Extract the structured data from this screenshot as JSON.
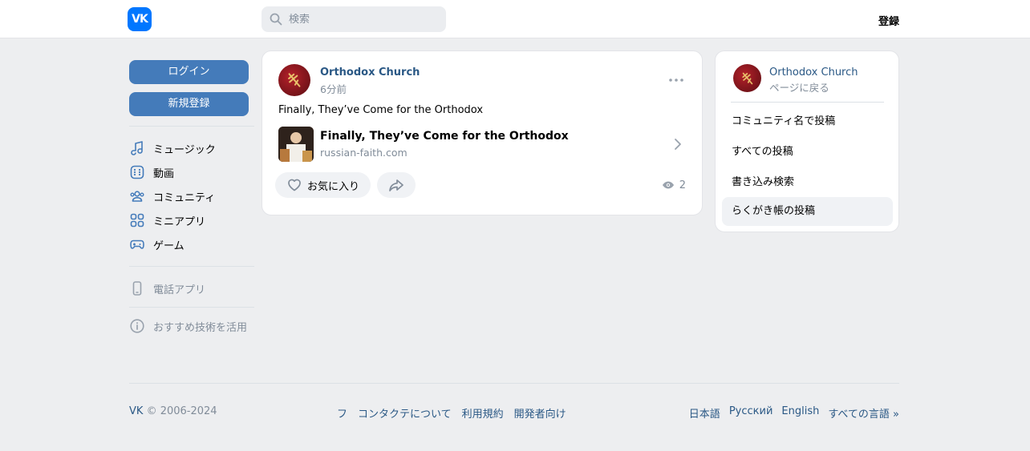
{
  "header": {
    "logo_text": "VK",
    "search_placeholder": "検索",
    "register_label": "登録"
  },
  "left_sidebar": {
    "login_label": "ログイン",
    "signup_label": "新規登録",
    "nav": [
      {
        "label": "ミュージック",
        "icon": "music-icon"
      },
      {
        "label": "動画",
        "icon": "video-icon"
      },
      {
        "label": "コミュニティ",
        "icon": "community-icon"
      },
      {
        "label": "ミニアプリ",
        "icon": "mini-apps-icon"
      },
      {
        "label": "ゲーム",
        "icon": "games-icon"
      }
    ],
    "phone_app_label": "電話アプリ",
    "recommend_label": "おすすめ技術を活用"
  },
  "post": {
    "author": "Orthodox Church",
    "time": "6分前",
    "text": "Finally, They’ve Come for the Orthodox",
    "link_title": "Finally, They’ve Come for the Orthodox",
    "link_domain": "russian-faith.com",
    "like_label": "お気に入り",
    "views": "2"
  },
  "right_panel": {
    "name": "Orthodox Church",
    "back_label": "ページに戻る",
    "items": [
      {
        "label": "コミュニティ名で投稿",
        "active": false
      },
      {
        "label": "すべての投稿",
        "active": false
      },
      {
        "label": "書き込み検索",
        "active": false
      },
      {
        "label": "らくがき帳の投稿",
        "active": true
      }
    ]
  },
  "footer": {
    "copy_brand": "VK",
    "copy_years": "© 2006-2024",
    "links": [
      "フ",
      "コンタクテについて",
      "利用規約",
      "開発者向け"
    ],
    "languages": [
      "日本語",
      "Русский",
      "English",
      "すべての言語 »"
    ]
  },
  "colors": {
    "accent": "#447bba",
    "link": "#2a5885",
    "logo": "#0077ff",
    "background": "#edeef0"
  }
}
